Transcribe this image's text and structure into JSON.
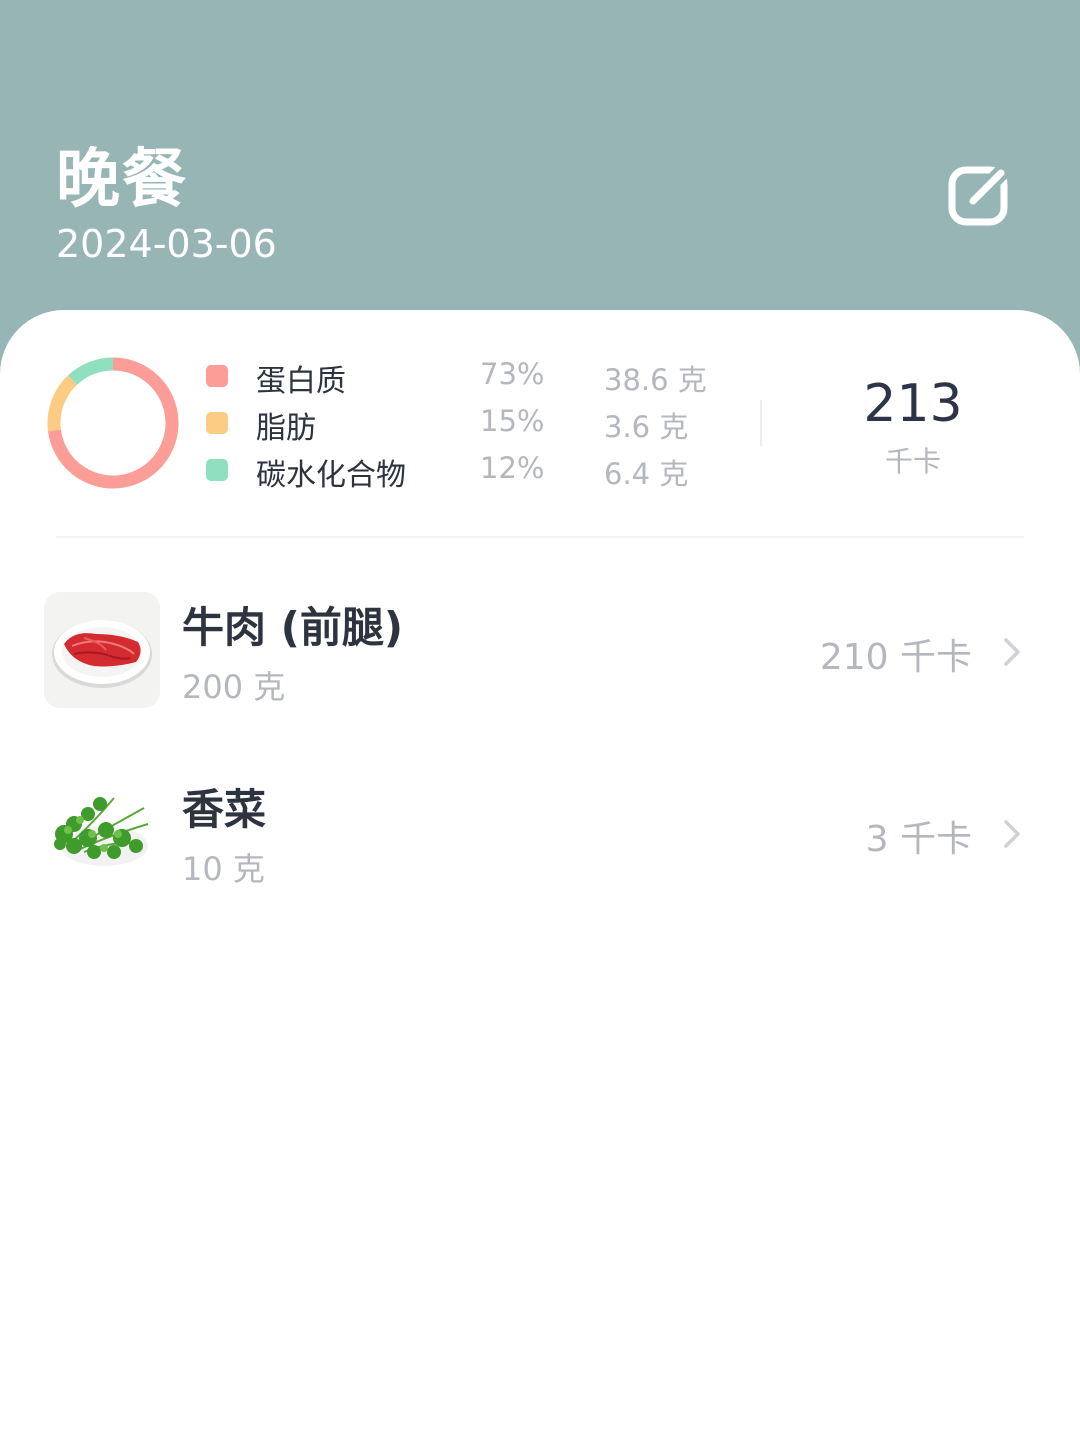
{
  "header": {
    "title": "晚餐",
    "date": "2024-03-06"
  },
  "nutrition": {
    "chart_data": {
      "type": "pie",
      "categories": [
        "蛋白质",
        "脂肪",
        "碳水化合物"
      ],
      "values": [
        73,
        15,
        12
      ],
      "colors": [
        "#fd9d98",
        "#fccb84",
        "#8fe0bf"
      ]
    },
    "macros": [
      {
        "name": "蛋白质",
        "percent": "73%",
        "grams": "38.6 克",
        "color": "#fd9d98"
      },
      {
        "name": "脂肪",
        "percent": "15%",
        "grams": "3.6 克",
        "color": "#fccb84"
      },
      {
        "name": "碳水化合物",
        "percent": "12%",
        "grams": "6.4 克",
        "color": "#8fe0bf"
      }
    ],
    "total_kcal": "213",
    "kcal_unit": "千卡"
  },
  "foods": [
    {
      "name": "牛肉 (前腿)",
      "amount": "200 克",
      "kcal": "210 千卡",
      "icon": "beef-image"
    },
    {
      "name": "香菜",
      "amount": "10 克",
      "kcal": "3 千卡",
      "icon": "cilantro-image"
    }
  ],
  "colors": {
    "header_bg": "#97b5b5",
    "text_primary": "#2e3340",
    "text_secondary": "#b4b7be"
  }
}
